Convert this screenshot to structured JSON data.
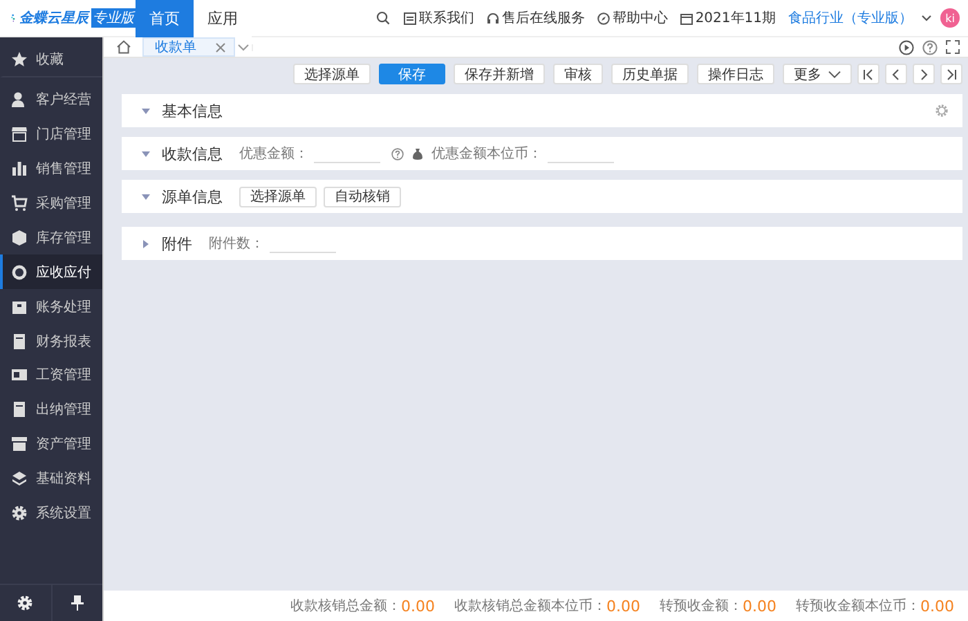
{
  "header": {
    "logo": "金蝶云星辰",
    "edition_badge": "专业版",
    "nav_tabs": [
      {
        "label": "首页",
        "selected": true
      },
      {
        "label": "应用",
        "selected": false
      }
    ],
    "links": [
      "联系我们",
      "售后在线服务",
      "帮助中心"
    ],
    "period": "2021年11期",
    "org": "食品行业（专业版）",
    "avatar": "ki"
  },
  "sidebar": {
    "items": [
      {
        "label": "收藏",
        "selected": false
      },
      {
        "label": "客户经营",
        "selected": false
      },
      {
        "label": "门店管理",
        "selected": false
      },
      {
        "label": "销售管理",
        "selected": false
      },
      {
        "label": "采购管理",
        "selected": false
      },
      {
        "label": "库存管理",
        "selected": false
      },
      {
        "label": "应收应付",
        "selected": true
      },
      {
        "label": "账务处理",
        "selected": false
      },
      {
        "label": "财务报表",
        "selected": false
      },
      {
        "label": "工资管理",
        "selected": false
      },
      {
        "label": "出纳管理",
        "selected": false
      },
      {
        "label": "资产管理",
        "selected": false
      },
      {
        "label": "基础资料",
        "selected": false
      },
      {
        "label": "系统设置",
        "selected": false
      }
    ]
  },
  "doc_tabs": [
    {
      "label": "收款单",
      "selected": true
    }
  ],
  "toolbar": {
    "buttons": [
      {
        "label": "选择源单",
        "primary": false
      },
      {
        "label": "保存",
        "primary": true
      },
      {
        "label": "保存并新增",
        "primary": false
      },
      {
        "label": "审核",
        "primary": false
      },
      {
        "label": "历史单据",
        "primary": false
      },
      {
        "label": "操作日志",
        "primary": false
      }
    ],
    "more": "更多"
  },
  "sections": [
    {
      "kind": "plain",
      "title": "基本信息",
      "expanded": true
    },
    {
      "kind": "fields",
      "title": "收款信息",
      "expanded": true,
      "fields": [
        {
          "label": "优惠金额："
        },
        {
          "label": "优惠金额本位币："
        }
      ]
    },
    {
      "kind": "buttons",
      "title": "源单信息",
      "expanded": true,
      "buttons": [
        "选择源单",
        "自动核销"
      ]
    },
    {
      "kind": "fields",
      "title": "附件",
      "expanded": false,
      "fields": [
        {
          "label": "附件数："
        }
      ]
    }
  ],
  "footer": {
    "totals": [
      {
        "label": "收款核销总金额：",
        "value": "0.00"
      },
      {
        "label": "收款核销总金额本位币：",
        "value": "0.00"
      },
      {
        "label": "转预收金额：",
        "value": "0.00"
      },
      {
        "label": "转预收金额本位币：",
        "value": "0.00"
      }
    ]
  }
}
